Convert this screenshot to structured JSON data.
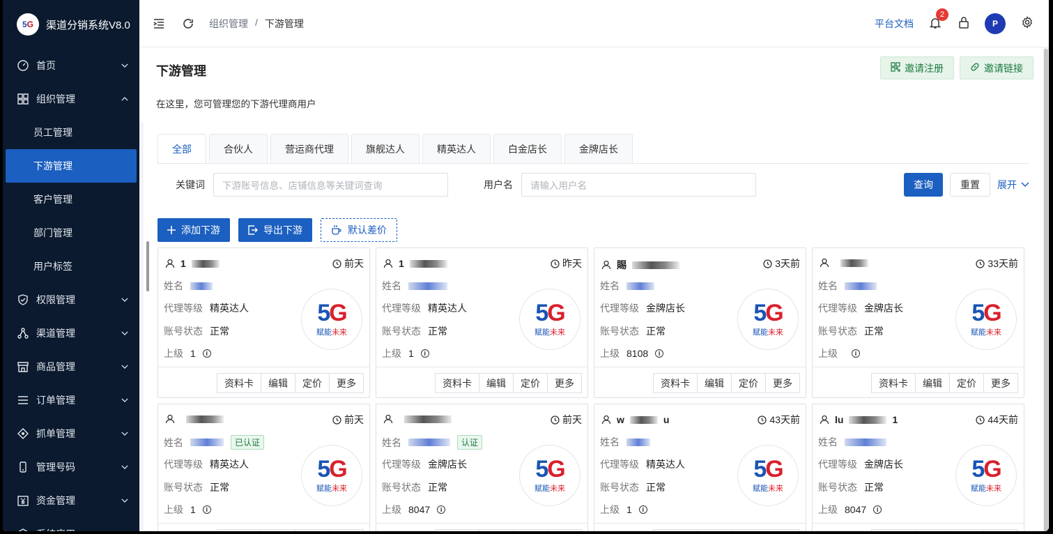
{
  "app": {
    "title": "渠道分销系统V8.0",
    "logo_text": "5G"
  },
  "sidebar": {
    "items": [
      {
        "label": "首页",
        "icon": "dashboard-icon",
        "expanded": false
      },
      {
        "label": "组织管理",
        "icon": "grid-icon",
        "expanded": true
      },
      {
        "label": "员工管理",
        "sub": true
      },
      {
        "label": "下游管理",
        "sub": true,
        "active": true
      },
      {
        "label": "客户管理",
        "sub": true
      },
      {
        "label": "部门管理",
        "sub": true
      },
      {
        "label": "用户标签",
        "sub": true
      },
      {
        "label": "权限管理",
        "icon": "shield-icon",
        "expanded": false
      },
      {
        "label": "渠道管理",
        "icon": "network-icon",
        "expanded": false
      },
      {
        "label": "商品管理",
        "icon": "store-icon",
        "expanded": false
      },
      {
        "label": "订单管理",
        "icon": "list-icon",
        "expanded": false
      },
      {
        "label": "抓单管理",
        "icon": "target-icon",
        "expanded": false
      },
      {
        "label": "管理号码",
        "icon": "phone-icon",
        "expanded": false
      },
      {
        "label": "资金管理",
        "icon": "money-icon",
        "expanded": false
      },
      {
        "label": "系统应用",
        "icon": "app-icon",
        "expanded": false
      }
    ]
  },
  "header": {
    "breadcrumb": [
      "组织管理",
      "/",
      "下游管理"
    ],
    "doc_link": "平台文档",
    "notification_count": "2"
  },
  "page": {
    "title": "下游管理",
    "description": "在这里，您可管理您的下游代理商用户",
    "invite_register": "邀请注册",
    "invite_link": "邀请链接"
  },
  "tabs": [
    "全部",
    "合伙人",
    "营运商代理",
    "旗舰达人",
    "精英达人",
    "白金店长",
    "金牌店长"
  ],
  "search": {
    "keyword_label": "关键词",
    "keyword_placeholder": "下游账号信息、店铺信息等关键词查询",
    "username_label": "用户名",
    "username_placeholder": "请输入用户名",
    "query": "查询",
    "reset": "重置",
    "expand": "展开"
  },
  "actions": {
    "add": "添加下游",
    "export": "导出下游",
    "default_diff": "默认差价"
  },
  "labels": {
    "name": "姓名",
    "level": "代理等级",
    "status": "账号状态",
    "parent": "上级",
    "certified": "已认证",
    "certified_partial": "认证",
    "btn_card": "资料卡",
    "btn_edit": "编辑",
    "btn_price": "定价",
    "btn_more": "更多",
    "logo_big_5": "5",
    "logo_big_g": "G",
    "logo_small_a": "赋能",
    "logo_small_b": "未来"
  },
  "cards": [
    {
      "user": "1",
      "time": "前天",
      "level": "精英达人",
      "status": "正常",
      "parent": "1",
      "cert": ""
    },
    {
      "user": "1",
      "time": "昨天",
      "level": "精英达人",
      "status": "正常",
      "parent": "1",
      "cert": ""
    },
    {
      "user": "賜",
      "time": "3天前",
      "level": "金牌店长",
      "status": "正常",
      "parent": "8108",
      "cert": ""
    },
    {
      "user": "",
      "time": "33天前",
      "level": "金牌店长",
      "status": "正常",
      "parent": "",
      "cert": ""
    },
    {
      "user": "",
      "time": "前天",
      "level": "精英达人",
      "status": "正常",
      "parent": "1",
      "cert": "已认证"
    },
    {
      "user": "",
      "time": "前天",
      "level": "金牌店长",
      "status": "正常",
      "parent": "8047",
      "cert": "认证"
    },
    {
      "user": "w",
      "user_b": "u",
      "time": "43天前",
      "level": "精英达人",
      "status": "正常",
      "parent": "1",
      "cert": ""
    },
    {
      "user": "lu",
      "user_b": "1",
      "time": "44天前",
      "level": "金牌店长",
      "status": "正常",
      "parent": "8047",
      "cert": ""
    }
  ]
}
